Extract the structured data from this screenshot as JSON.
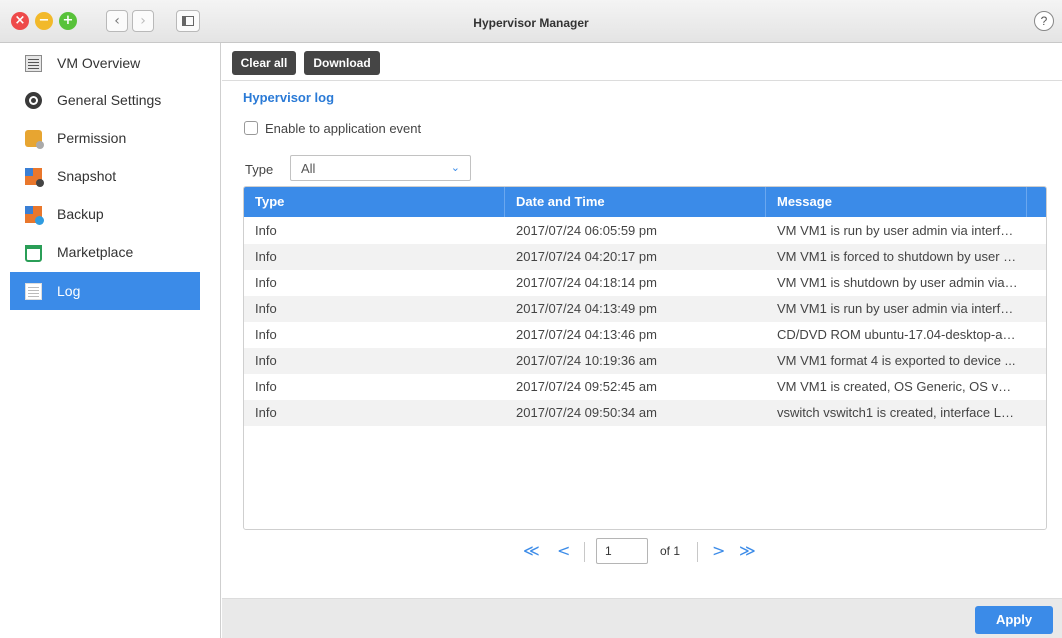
{
  "window": {
    "title": "Hypervisor Manager",
    "help_glyph": "?",
    "back_glyph": "‹",
    "forward_glyph": "›",
    "close_glyph": "×",
    "min_glyph": "−",
    "max_glyph": "+"
  },
  "sidebar": {
    "items": [
      {
        "label": "VM Overview",
        "icon": "vm-overview-icon"
      },
      {
        "label": "General Settings",
        "icon": "settings-gear-icon"
      },
      {
        "label": "Permission",
        "icon": "permission-lock-icon"
      },
      {
        "label": "Snapshot",
        "icon": "snapshot-icon"
      },
      {
        "label": "Backup",
        "icon": "backup-icon"
      },
      {
        "label": "Marketplace",
        "icon": "cart-icon"
      },
      {
        "label": "Log",
        "icon": "log-list-icon",
        "active": true
      }
    ]
  },
  "toolbar": {
    "clear_all": "Clear all",
    "download": "Download"
  },
  "log": {
    "title": "Hypervisor log",
    "enable_label": "Enable to application event",
    "enable_checked": false,
    "type_label": "Type",
    "type_value": "All"
  },
  "table": {
    "columns": [
      "Type",
      "Date and Time",
      "Message"
    ],
    "rows": [
      [
        "Info",
        "2017/07/24 06:05:59 pm",
        "VM VM1 is run by user admin via interfa..."
      ],
      [
        "Info",
        "2017/07/24 04:20:17 pm",
        "VM VM1 is forced to shutdown by user a..."
      ],
      [
        "Info",
        "2017/07/24 04:18:14 pm",
        "VM VM1 is shutdown by user admin via i..."
      ],
      [
        "Info",
        "2017/07/24 04:13:49 pm",
        "VM VM1 is run by user admin via interfa..."
      ],
      [
        "Info",
        "2017/07/24 04:13:46 pm",
        "CD/DVD ROM ubuntu-17.04-desktop-am..."
      ],
      [
        "Info",
        "2017/07/24 10:19:36 am",
        "VM VM1 format 4 is exported to device ..."
      ],
      [
        "Info",
        "2017/07/24 09:52:45 am",
        "VM VM1 is created, OS Generic, OS versi..."
      ],
      [
        "Info",
        "2017/07/24 09:50:34 am",
        "vswitch vswitch1 is created, interface LA..."
      ]
    ]
  },
  "pager": {
    "first": "≪",
    "prev": "<",
    "next": ">",
    "last": "≫",
    "page": "1",
    "of": "of 1"
  },
  "footer": {
    "apply": "Apply"
  },
  "colors": {
    "accent": "#3b8be8",
    "toolbar_button": "#454545"
  }
}
